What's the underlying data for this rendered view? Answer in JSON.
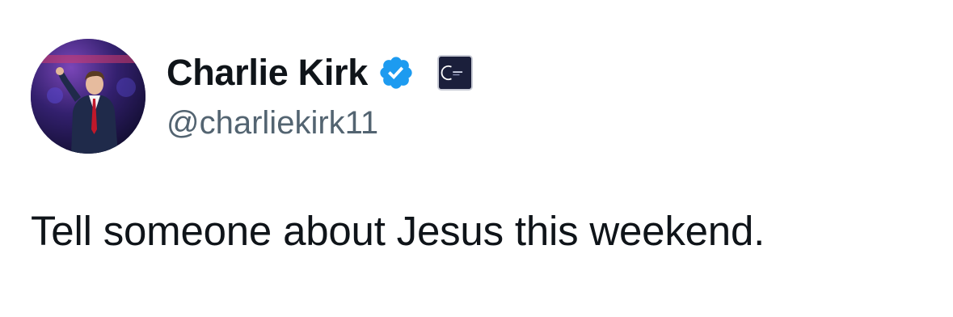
{
  "author": {
    "display_name": "Charlie Kirk",
    "handle": "@charliekirk11",
    "verified_icon": "verified-badge-icon",
    "verified_color": "#1d9bf0",
    "affiliate_icon": "organization-affiliate-badge-icon"
  },
  "tweet": {
    "text": "Tell someone about Jesus this weekend."
  },
  "colors": {
    "name": "#0f1419",
    "handle": "#536471",
    "text": "#0f1419",
    "background": "#ffffff"
  }
}
